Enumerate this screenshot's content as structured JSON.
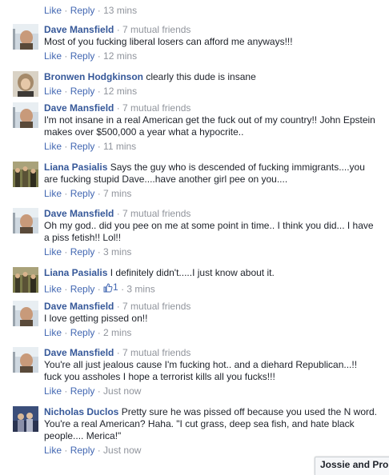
{
  "first_actions": {
    "like_label": "Like",
    "reply_label": "Reply",
    "time": "13 mins"
  },
  "comments": [
    {
      "author": "Dave Mansfield",
      "meta": "7 mutual friends",
      "text": "Most of you fucking liberal losers can afford me anyways!!!",
      "like_label": "Like",
      "reply_label": "Reply",
      "time": "12 mins",
      "avatar": "dave"
    },
    {
      "author": "Bronwen Hodgkinson",
      "meta": "",
      "text": "clearly this dude is insane",
      "like_label": "Like",
      "reply_label": "Reply",
      "time": "12 mins",
      "avatar": "bronwen"
    },
    {
      "author": "Dave Mansfield",
      "meta": "7 mutual friends",
      "text": "I'm not insane in a real American get the fuck out of my country!! John Epstein makes over $500,000 a year what a hypocrite..",
      "like_label": "Like",
      "reply_label": "Reply",
      "time": "11 mins",
      "avatar": "dave"
    },
    {
      "author": "Liana Pasialis",
      "meta": "",
      "text": "Says the guy who is descended of fucking immigrants....you are fucking stupid Dave....have another girl pee on you....",
      "like_label": "Like",
      "reply_label": "Reply",
      "time": "7 mins",
      "avatar": "liana"
    },
    {
      "author": "Dave Mansfield",
      "meta": "7 mutual friends",
      "text": "Oh my god.. did you pee on me at some point in time.. I think you did... I have a piss fetish!! Lol!!",
      "like_label": "Like",
      "reply_label": "Reply",
      "time": "3 mins",
      "avatar": "dave"
    },
    {
      "author": "Liana Pasialis",
      "meta": "",
      "text": "I definitely didn't.....I just know about it.",
      "like_label": "Like",
      "reply_label": "Reply",
      "like_count": "1",
      "time": "3 mins",
      "avatar": "liana"
    },
    {
      "author": "Dave Mansfield",
      "meta": "7 mutual friends",
      "text": "I love getting pissed on!!",
      "like_label": "Like",
      "reply_label": "Reply",
      "time": "2 mins",
      "avatar": "dave"
    },
    {
      "author": "Dave Mansfield",
      "meta": "7 mutual friends",
      "text": "You're all just jealous cause I'm fucking hot.. and a diehard Republican...!! fuck you assholes I hope a terrorist kills all you fucks!!!",
      "like_label": "Like",
      "reply_label": "Reply",
      "time": "Just now",
      "avatar": "dave"
    },
    {
      "author": "Nicholas Duclos",
      "meta": "",
      "text": "Pretty sure he was pissed off because you used the N word. You're a real American? Haha. \"I cut grass, deep sea fish, and hate black people.... Merica!\"",
      "like_label": "Like",
      "reply_label": "Reply",
      "time": "Just now",
      "avatar": "nicholas"
    }
  ],
  "chat_tab": {
    "label": "Jossie and Prom"
  },
  "colors": {
    "author_link": "#365899",
    "action_link": "#4267b2",
    "meta_gray": "#90949c",
    "body_text": "#1d2129"
  }
}
